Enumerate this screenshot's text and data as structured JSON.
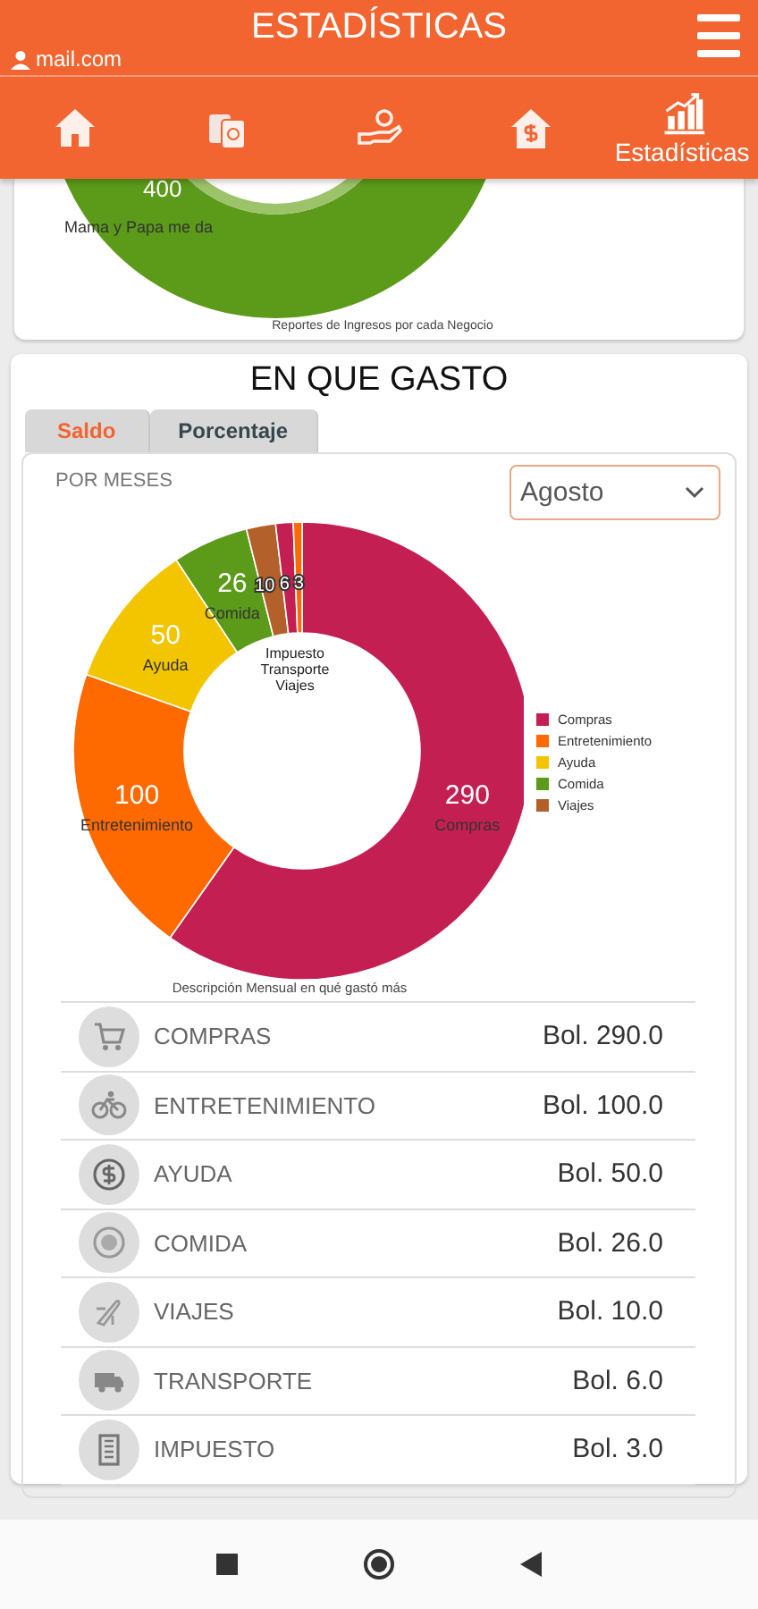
{
  "header": {
    "title": "ESTADÍSTICAS",
    "account": "mail.com"
  },
  "nav": [
    {
      "kind": "home",
      "selected": false
    },
    {
      "kind": "cash",
      "selected": false
    },
    {
      "kind": "hand",
      "selected": false
    },
    {
      "kind": "house-dollar",
      "selected": false
    },
    {
      "kind": "stats",
      "selected": true,
      "label": "Estadísticas"
    }
  ],
  "income_card": {
    "slice_value": "400",
    "slice_label": "Mama y Papa me da",
    "caption": "Reportes de Ingresos por cada Negocio"
  },
  "spend_card": {
    "title": "EN QUE GASTO",
    "tabs": [
      {
        "label": "Saldo",
        "selected": true
      },
      {
        "label": "Porcentaje",
        "selected": false
      }
    ],
    "period_label": "POR MESES",
    "month": {
      "value": "Agosto"
    },
    "chart_data": {
      "type": "donut",
      "categories": [
        "Compras",
        "Entretenimiento",
        "Ayuda",
        "Comida",
        "Viajes",
        "Transporte",
        "Impuesto"
      ],
      "values": [
        290,
        100,
        50,
        26,
        10,
        6,
        3
      ],
      "colors": [
        "#c41f52",
        "#ff6a00",
        "#f2c500",
        "#5c9a1a",
        "#b3602a",
        "#c41f52",
        "#ff6a00"
      ],
      "data_labels": true
    },
    "legend": [
      {
        "name": "Compras",
        "color": "#c41f52"
      },
      {
        "name": "Entretenimiento",
        "color": "#ff6a00"
      },
      {
        "name": "Ayuda",
        "color": "#f2c500"
      },
      {
        "name": "Comida",
        "color": "#5c9a1a"
      },
      {
        "name": "Viajes",
        "color": "#b3602a"
      }
    ],
    "chart_caption": "Descripción Mensual en qué gastó más",
    "rows": [
      {
        "kind": "cart",
        "name": "COMPRAS",
        "amount": "Bol. 290.0"
      },
      {
        "kind": "bike",
        "name": "ENTRETENIMIENTO",
        "amount": "Bol. 100.0"
      },
      {
        "kind": "coin",
        "name": "AYUDA",
        "amount": "Bol. 50.0"
      },
      {
        "kind": "food",
        "name": "COMIDA",
        "amount": "Bol. 26.0"
      },
      {
        "kind": "plane",
        "name": "VIAJES",
        "amount": "Bol. 10.0"
      },
      {
        "kind": "truck",
        "name": "TRANSPORTE",
        "amount": "Bol. 6.0"
      },
      {
        "kind": "building",
        "name": "IMPUESTO",
        "amount": "Bol. 3.0"
      }
    ]
  }
}
